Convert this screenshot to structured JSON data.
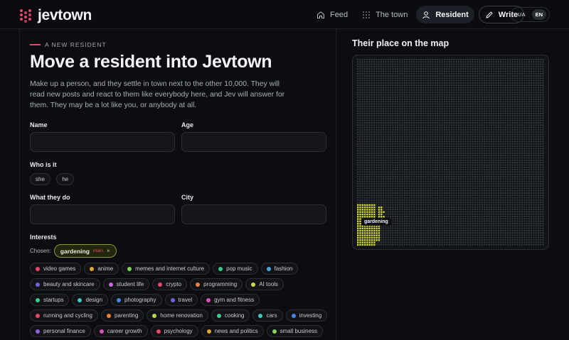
{
  "app": {
    "name": "jevtown"
  },
  "nav": {
    "feed": "Feed",
    "town": "The town",
    "resident": "Resident",
    "write": "Write"
  },
  "lang": {
    "ua": "UA",
    "en": "EN",
    "active": "EN"
  },
  "form": {
    "kicker": "A NEW RESIDENT",
    "title": "Move a resident into Jevtown",
    "intro": "Make up a person, and they settle in town next to the other 10,000. They will read new posts and react to them like everybody here, and Jev will answer for them. They may be a lot like you, or anybody at all.",
    "name_label": "Name",
    "name_value": "",
    "age_label": "Age",
    "age_value": "",
    "who_label": "Who is it",
    "pronouns": [
      "she",
      "he"
    ],
    "job_label": "What they do",
    "job_value": "",
    "city_label": "City",
    "city_value": "",
    "interests_label": "Interests",
    "chosen_label": "Chosen:",
    "chosen": {
      "name": "gardening",
      "tag": "main",
      "remove": "×"
    }
  },
  "interests": [
    [
      {
        "label": "video games",
        "color": "#e5486b"
      },
      {
        "label": "anime",
        "color": "#e0a43a"
      },
      {
        "label": "memes and internet culture",
        "color": "#7bd35a"
      },
      {
        "label": "pop music",
        "color": "#3fc98a"
      },
      {
        "label": "fashion",
        "color": "#4aa8d8"
      }
    ],
    [
      {
        "label": "beauty and skincare",
        "color": "#6d63d6"
      },
      {
        "label": "student life",
        "color": "#c66ad8"
      },
      {
        "label": "crypto",
        "color": "#e5486b"
      },
      {
        "label": "programming",
        "color": "#e8823a"
      },
      {
        "label": "AI tools",
        "color": "#d6d84a"
      }
    ],
    [
      {
        "label": "startups",
        "color": "#3fc98a"
      },
      {
        "label": "design",
        "color": "#3fc9c0"
      },
      {
        "label": "photography",
        "color": "#4a86e0"
      },
      {
        "label": "travel",
        "color": "#6d63d6"
      },
      {
        "label": "gym and fitness",
        "color": "#d654b4"
      }
    ],
    [
      {
        "label": "running and cycling",
        "color": "#e5486b"
      },
      {
        "label": "parenting",
        "color": "#e8823a"
      },
      {
        "label": "home renovation",
        "color": "#b8d84a"
      },
      {
        "label": "cooking",
        "color": "#3fc98a"
      },
      {
        "label": "cars",
        "color": "#3fc9c0"
      },
      {
        "label": "investing",
        "color": "#4a86e0"
      }
    ],
    [
      {
        "label": "personal finance",
        "color": "#8a63d6"
      },
      {
        "label": "career growth",
        "color": "#d654b4"
      },
      {
        "label": "psychology",
        "color": "#e5486b"
      },
      {
        "label": "news and politics",
        "color": "#e0a43a"
      },
      {
        "label": "small business",
        "color": "#8ad35a"
      }
    ]
  ],
  "map": {
    "title": "Their place on the map",
    "highlight_label": "gardening",
    "grid_color": "#3a3f47",
    "highlight_color": "#d4dc3a"
  }
}
